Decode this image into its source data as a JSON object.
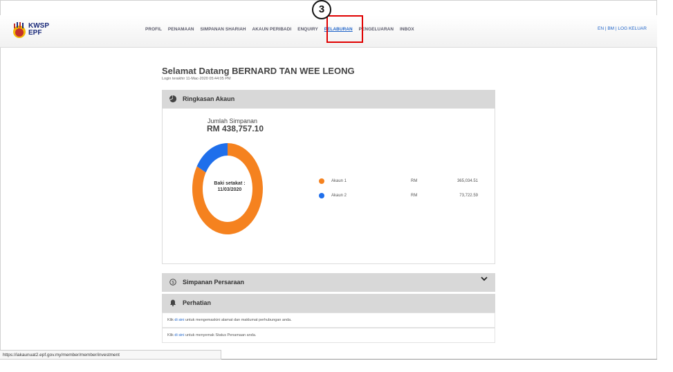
{
  "header": {
    "logo_line1": "KWSP",
    "logo_line2": "EPF",
    "nav_items": [
      "PROFIL",
      "PENAMAAN",
      "SIMPANAN SHARIAH",
      "AKAUN PERIBADI",
      "ENQUIRY",
      "PELABURAN",
      "PENGELUARAN",
      "INBOX"
    ],
    "active_item": "PELABURAN",
    "lang_links": [
      "EN",
      "BM",
      "LOG KELUAR"
    ],
    "step_marker": "3"
  },
  "welcome": {
    "title": "Selamat Datang BERNARD TAN WEE LEONG",
    "last_login": "Login terakhir 11-Mac-2020 05:44:05 PM"
  },
  "summary": {
    "title": "Ringkasan Akaun",
    "icon": "pie-chart-icon",
    "total_label": "Jumlah Simpanan",
    "total_value": "RM 438,757.10",
    "center_line1": "Baki setakat :",
    "center_line2": "11/03/2020",
    "accounts": [
      {
        "name": "Akaun 1",
        "currency": "RM",
        "amount": "365,034.51",
        "value": 365034.51,
        "color": "#f5821f"
      },
      {
        "name": "Akaun 2",
        "currency": "RM",
        "amount": "73,722.59",
        "value": 73722.59,
        "color": "#1f6feb"
      }
    ]
  },
  "retirement": {
    "title": "Simpanan Persaraan",
    "icon": "dollar-circle-icon"
  },
  "notice": {
    "title": "Perhatian",
    "icon": "bell-icon",
    "rows": [
      {
        "prefix": "Klik ",
        "link": "di sini",
        "suffix": " untuk mengemaskini alamat dan maklumat perhubungan anda."
      },
      {
        "prefix": "Klik ",
        "link": "di sini",
        "suffix": " untuk menyemak Status Penamaan anda."
      }
    ]
  },
  "status_url": "https://iakaunuat2.epf.gov.my/member/member/investment"
}
